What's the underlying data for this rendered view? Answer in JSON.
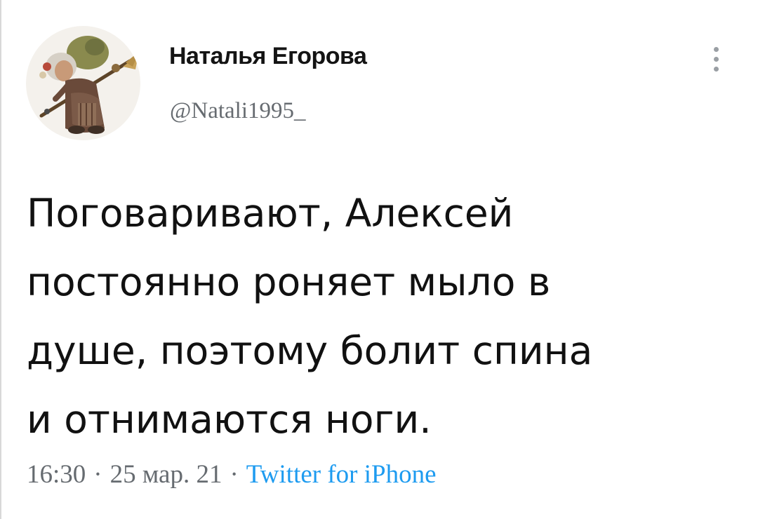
{
  "tweet": {
    "author": {
      "display_name": "Наталья Егорова",
      "handle": "@Natali1995_",
      "avatar": "witch-illustration-avatar"
    },
    "text": "Поговаривают, Алексей\nпостоянно роняет мыло в\nдуше, поэтому болит спина\nи отнимаются ноги.",
    "time": "16:30",
    "separator": "·",
    "date": "25 мар. 21",
    "source": "Twitter for iPhone"
  },
  "icons": {
    "more": "more-vertical-icon"
  },
  "colors": {
    "text": "#111111",
    "secondary_text": "#666b70",
    "link": "#1d9bf0",
    "background": "#ffffff"
  }
}
